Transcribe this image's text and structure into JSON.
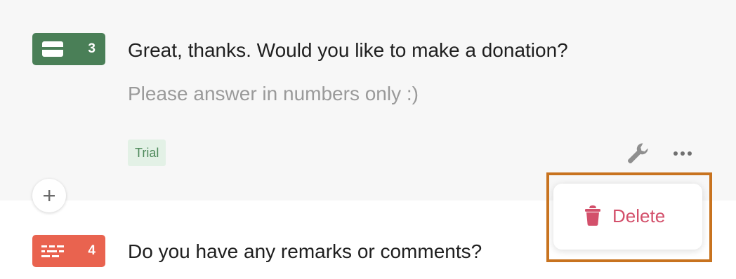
{
  "questions": [
    {
      "number": "3",
      "title": "Great, thanks. Would you like to make a donation?",
      "description": "Please answer in numbers only :)",
      "tag": "Trial",
      "icon": "payment-card-icon",
      "color": "#4a7f57"
    },
    {
      "number": "4",
      "title": "Do you have any remarks or comments?",
      "icon": "long-text-icon",
      "color": "#e9634f"
    }
  ],
  "menu": {
    "delete_label": "Delete",
    "delete_icon": "trash-icon",
    "delete_color": "#d3506b"
  },
  "toolbar": {
    "settings_icon": "wrench-icon",
    "more_icon": "more-options-icon"
  },
  "add_button_icon": "plus-icon",
  "highlight_color": "#c8731f"
}
